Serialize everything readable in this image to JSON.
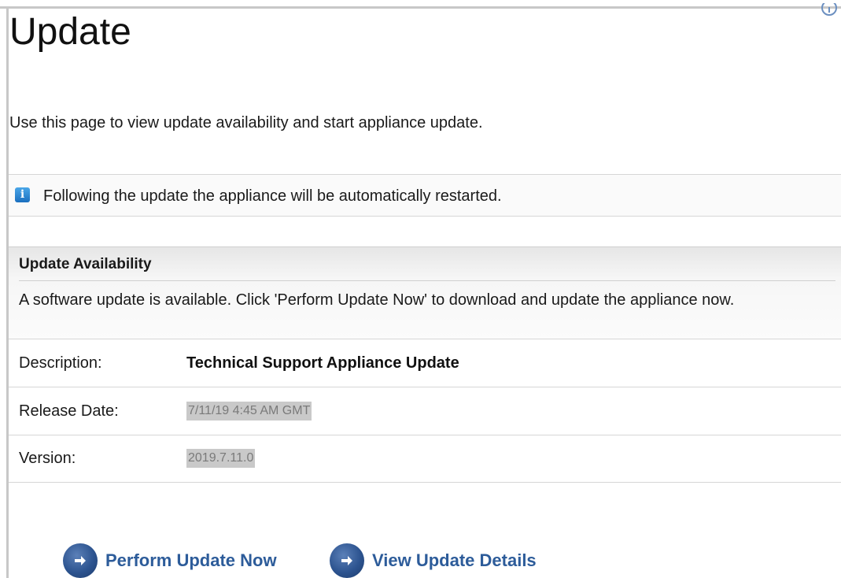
{
  "page": {
    "title": "Update",
    "intro": "Use this page to view update availability and start appliance update."
  },
  "notice": {
    "icon": "info-icon",
    "text": "Following the update the appliance will be automatically restarted."
  },
  "availability": {
    "title": "Update Availability",
    "description": "A software update is available. Click 'Perform Update Now' to download and update the appliance now."
  },
  "details": [
    {
      "label": "Description:",
      "value": "Technical Support Appliance Update"
    },
    {
      "label": "Release Date:",
      "value": "7/11/19 4:45 AM GMT"
    },
    {
      "label": "Version:",
      "value": "2019.7.11.0"
    }
  ],
  "actions": {
    "perform": "Perform Update Now",
    "view": "View Update Details"
  },
  "colors": {
    "link": "#2d5c9a",
    "icon_blue": "#2d5490",
    "info_blue": "#1a6fbf"
  }
}
